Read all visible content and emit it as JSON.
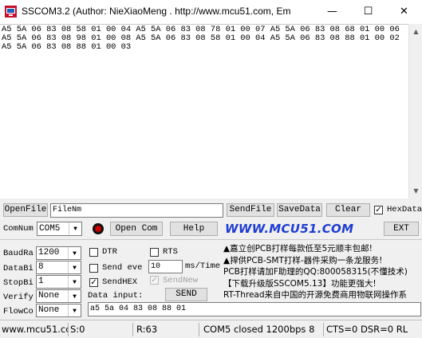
{
  "window": {
    "title": "SSCOM3.2 (Author: NieXiaoMeng .  http://www.mcu51.com,  Em",
    "minimize": "—",
    "maximize": "☐",
    "close": "✕"
  },
  "receive": {
    "text": "A5 5A 06 83 08 58 01 00 04 A5 5A 06 83 08 78 01 00 07 A5 5A 06 83 08 68 01 00 06 A5 5A 06 83 08 98 01 00 08 A5 5A 06 83 08 58 01 00 04 A5 5A 06 83 08 88 01 00 02 A5 5A 06 83 08 88 01 00 03"
  },
  "file_bar": {
    "open_file": "OpenFile",
    "file_name": "FileNm",
    "send_file": "SendFile",
    "save_data": "SaveData",
    "clear": "Clear",
    "hex_display_label": "HexData",
    "hex_display_checked": true
  },
  "com_bar": {
    "com_label": "ComNum",
    "com_value": "COM5",
    "open_com": "Open Com",
    "help": "Help",
    "logo": "WWW.MCU51.COM",
    "ext": "EXT",
    "indicator_color": "#cc0000"
  },
  "settings": {
    "baud_label": "BaudRa",
    "baud_value": "1200",
    "data_bits_label": "DataBi",
    "data_bits_value": "8",
    "stop_bits_label": "StopBi",
    "stop_bits_value": "1",
    "verify_label": "Verify",
    "verify_value": "None",
    "flow_label": "FlowCo",
    "flow_value": "None"
  },
  "options": {
    "dtr_label": "DTR",
    "dtr_checked": false,
    "rts_label": "RTS",
    "rts_checked": false,
    "send_every_label": "Send eve",
    "send_every_checked": false,
    "interval_value": "10",
    "interval_unit": "ms/Time",
    "send_hex_label": "SendHEX",
    "send_hex_checked": true,
    "send_new_label": "SendNew",
    "send_new_checked": true,
    "data_input_label": "Data input:",
    "send_button": "SEND",
    "input_value": "a5 5a 04 83 08 88 01"
  },
  "ads": {
    "line1": "▲嘉立创PCB打样每款低至5元顺丰包邮!",
    "line2": "▲捍供PCB-SMT打样-器件采购一条龙服务!",
    "line3": "PCB打样请加F助理的QQ:800058315(不懂技术)",
    "line4": "【下载升级版SSCOM5.13】功能更强大!",
    "line5": "RT-Thread来自中国的开源免费商用物联网操作系"
  },
  "status": {
    "website": "www.mcu51.cor",
    "sent": "S:0",
    "received": "R:63",
    "port_state": "COM5 closed  1200bps  8",
    "lines": "CTS=0 DSR=0 RL"
  }
}
